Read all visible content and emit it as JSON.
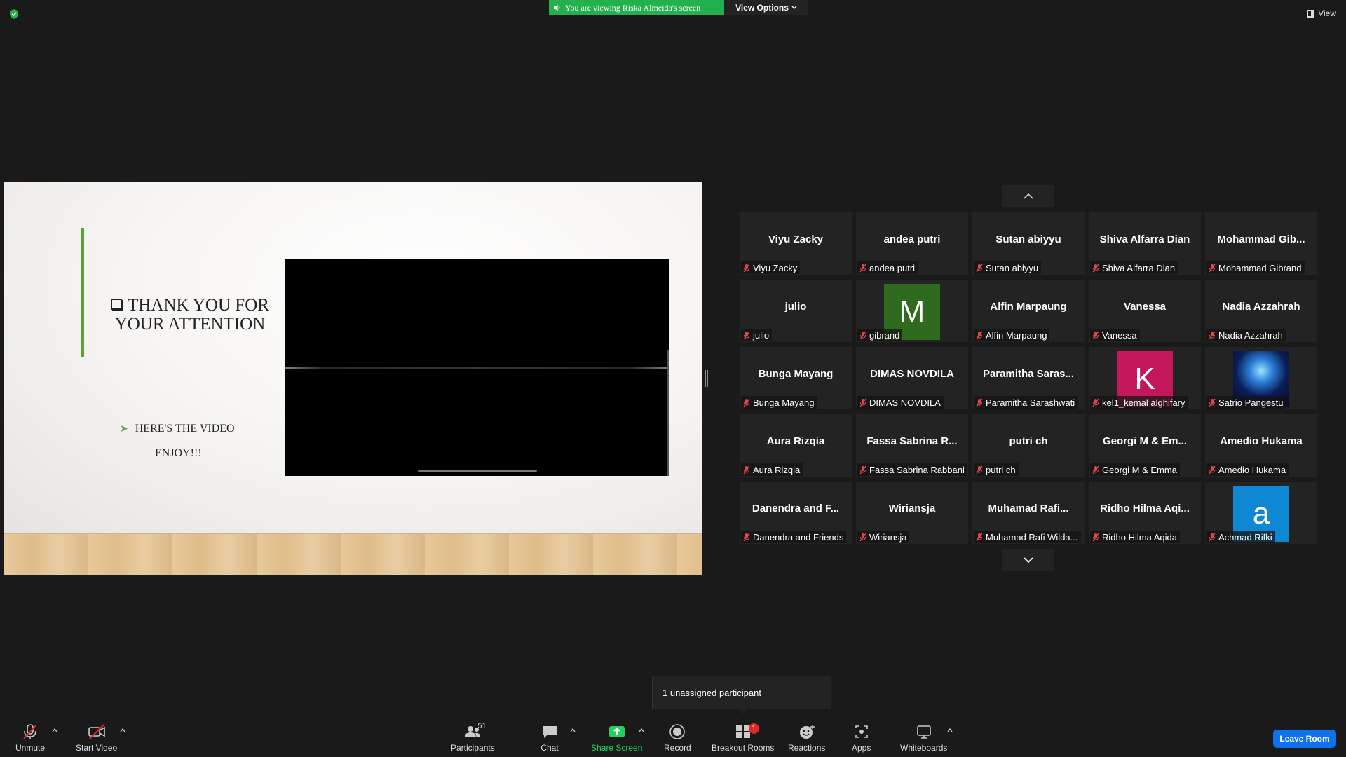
{
  "top": {
    "viewing_banner": "You are viewing Riska Almeida's screen",
    "view_options": "View Options",
    "view_label": "View"
  },
  "slide": {
    "title": "THANK YOU FOR YOUR ATTENTION",
    "sub1": "HERE'S THE VIDEO",
    "sub2": "ENJOY!!!"
  },
  "gallery": {
    "tiles": [
      {
        "big": "Viyu Zacky",
        "caption": "Viyu Zacky"
      },
      {
        "big": "andea putri",
        "caption": "andea putri"
      },
      {
        "big": "Sutan abiyyu",
        "caption": "Sutan abiyyu"
      },
      {
        "big": "Shiva Alfarra Dian",
        "caption": "Shiva Alfarra Dian"
      },
      {
        "big": "Mohammad  Gib...",
        "caption": "Mohammad Gibrand"
      },
      {
        "big": "julio",
        "caption": "julio"
      },
      {
        "big": "",
        "avatar": "M",
        "caption": "gibrand"
      },
      {
        "big": "Alfin Marpaung",
        "caption": "Alfin Marpaung"
      },
      {
        "big": "Vanessa",
        "caption": "Vanessa"
      },
      {
        "big": "Nadia Azzahrah",
        "caption": "Nadia Azzahrah"
      },
      {
        "big": "Bunga Mayang",
        "caption": "Bunga Mayang"
      },
      {
        "big": "DIMAS NOVDILA",
        "caption": "DIMAS NOVDILA"
      },
      {
        "big": "Paramitha  Saras...",
        "caption": "Paramitha Sarashwati"
      },
      {
        "big": "",
        "avatar": "K",
        "caption": "kel1_kemal alghifary"
      },
      {
        "big": "",
        "avatar": "",
        "caption": "Satrio Pangestu"
      },
      {
        "big": "Aura Rizqia",
        "caption": "Aura Rizqia"
      },
      {
        "big": "Fassa Sabrina R...",
        "caption": "Fassa Sabrina Rabbani"
      },
      {
        "big": "putri ch",
        "caption": "putri ch"
      },
      {
        "big": "Georgi M & Em...",
        "caption": "Georgi M & Emma"
      },
      {
        "big": "Amedio Hukama",
        "caption": "Amedio Hukama"
      },
      {
        "big": "Danendra  and  F...",
        "caption": "Danendra and Friends"
      },
      {
        "big": "Wiriansja",
        "caption": "Wiriansja"
      },
      {
        "big": "Muhamad  Rafi...",
        "caption": "Muhamad Rafi Wilda..."
      },
      {
        "big": "Ridho  Hilma  Aqi...",
        "caption": "Ridho Hilma Aqida"
      },
      {
        "big": "",
        "avatar": "a",
        "caption": "Achmad Rifki"
      }
    ]
  },
  "toast": "1 unassigned participant",
  "toolbar": {
    "unmute": "Unmute",
    "start_video": "Start Video",
    "participants": "Participants",
    "participants_count": "51",
    "chat": "Chat",
    "share_screen": "Share Screen",
    "record": "Record",
    "breakout_rooms": "Breakout Rooms",
    "breakout_badge": "1",
    "reactions": "Reactions",
    "apps": "Apps",
    "whiteboards": "Whiteboards",
    "leave_room": "Leave Room"
  },
  "colors": {
    "accent_green": "#23b14d",
    "leave_blue": "#0e72ed",
    "background": "#1a1a1a",
    "tile_bg": "#232323"
  }
}
